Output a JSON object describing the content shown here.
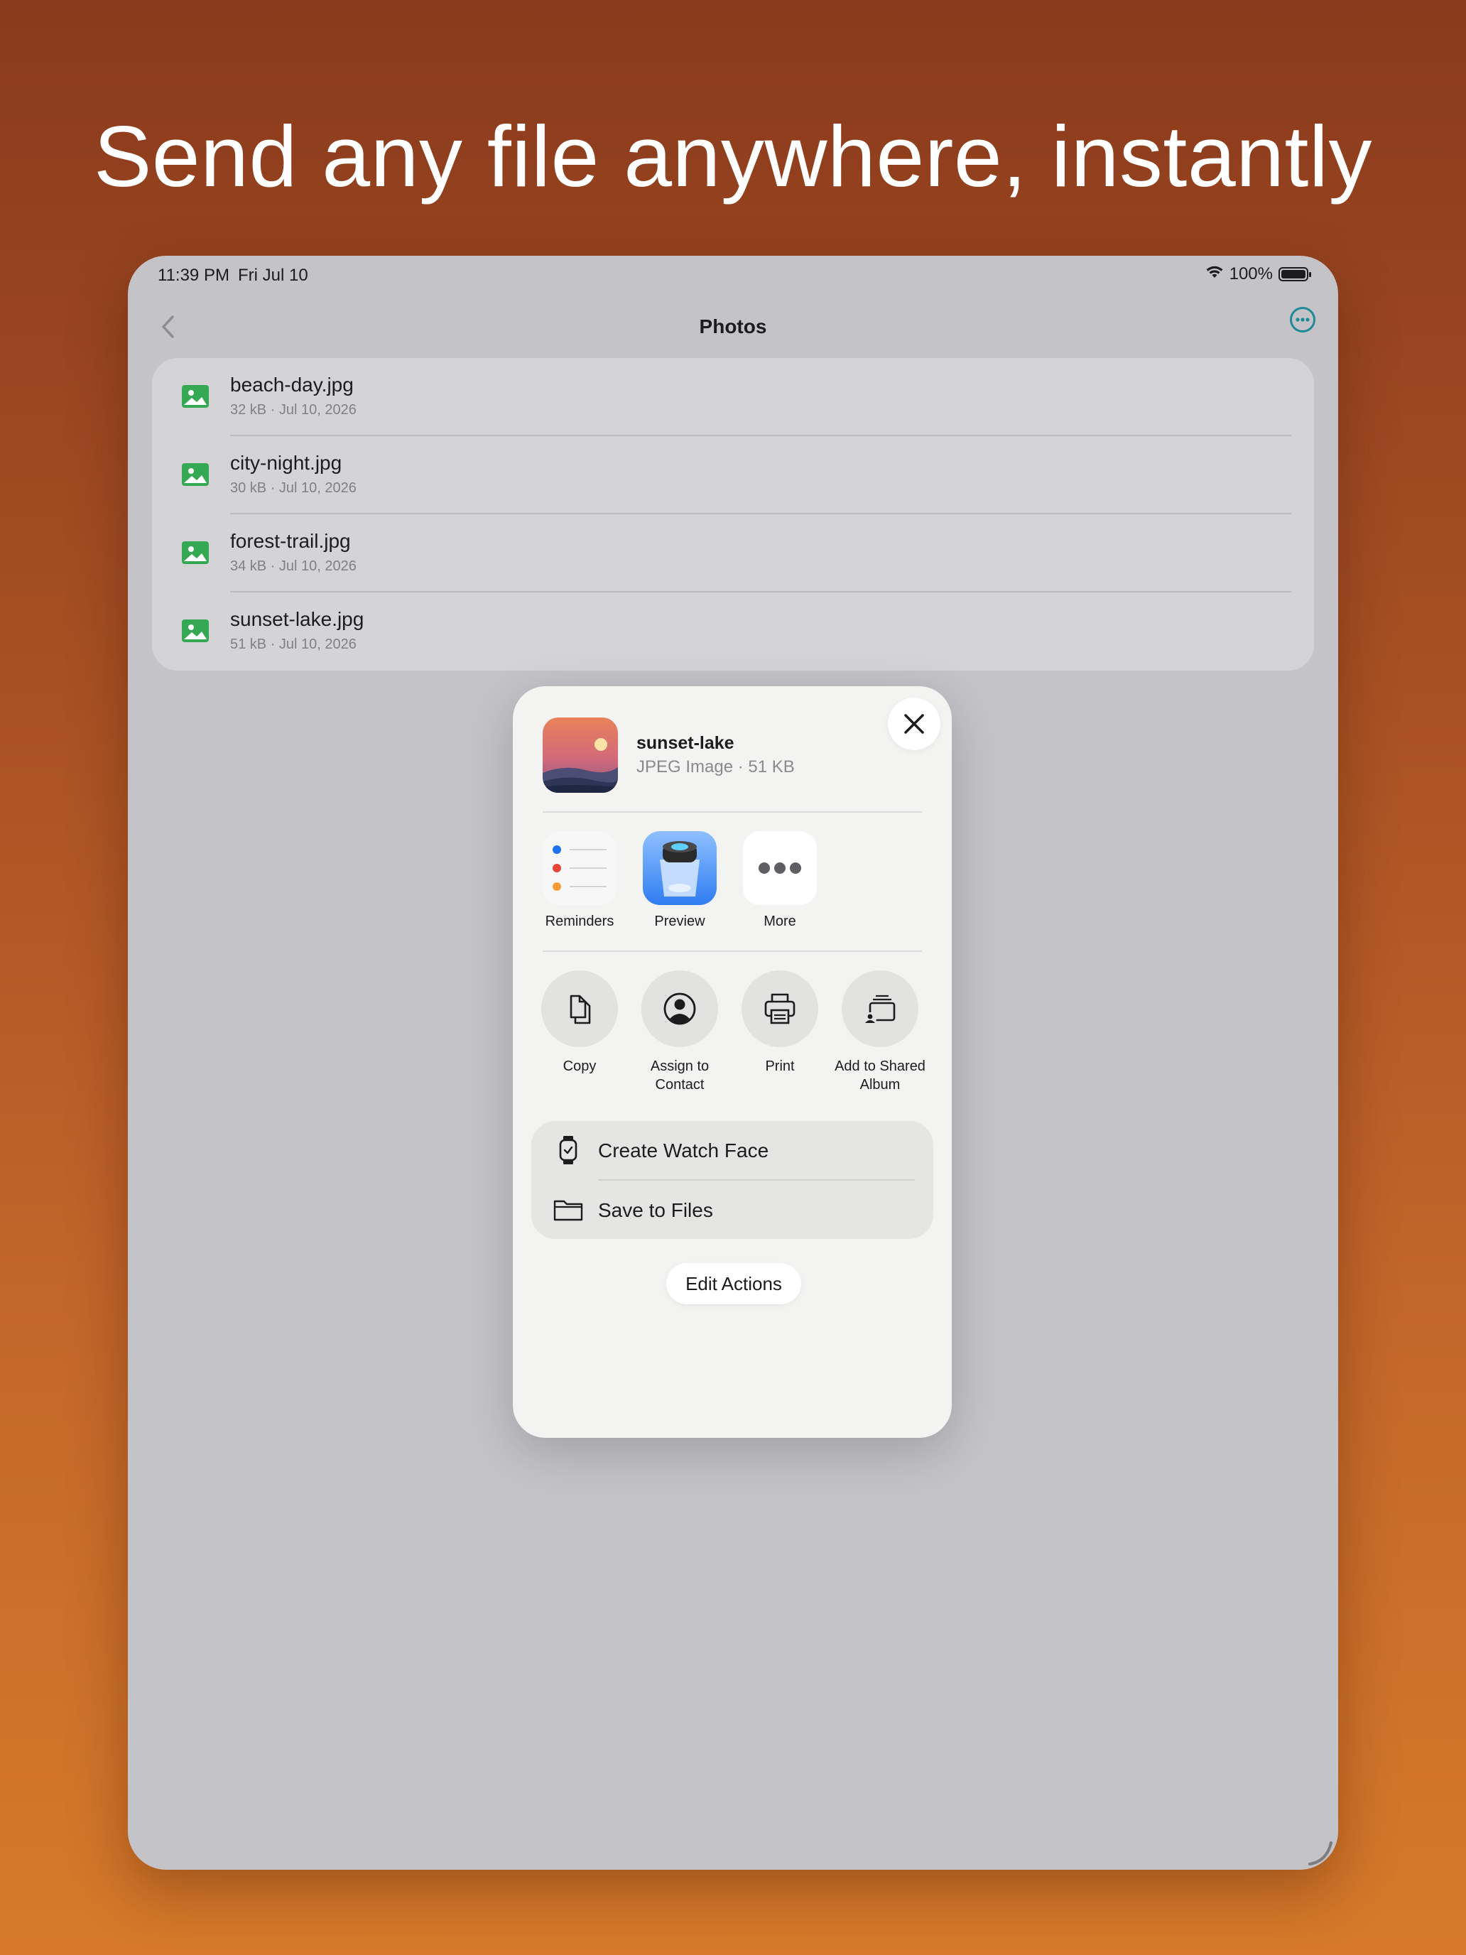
{
  "headline": "Send any file anywhere, instantly",
  "status_bar": {
    "time": "11:39 PM",
    "date": "Fri Jul 10",
    "battery": "100%"
  },
  "nav": {
    "title": "Photos"
  },
  "files": [
    {
      "name": "beach-day.jpg",
      "meta": "32 kB · Jul 10, 2026"
    },
    {
      "name": "city-night.jpg",
      "meta": "30 kB · Jul 10, 2026"
    },
    {
      "name": "forest-trail.jpg",
      "meta": "34 kB · Jul 10, 2026"
    },
    {
      "name": "sunset-lake.jpg",
      "meta": "51 kB · Jul 10, 2026"
    }
  ],
  "share_sheet": {
    "file_title": "sunset-lake",
    "file_subtitle": "JPEG Image · 51 KB",
    "apps": [
      {
        "label": "Reminders",
        "icon": "reminders-icon"
      },
      {
        "label": "Preview",
        "icon": "preview-icon"
      },
      {
        "label": "More",
        "icon": "more-icon"
      }
    ],
    "actions": [
      {
        "label": "Copy",
        "icon": "copy-icon"
      },
      {
        "label": "Assign to Contact",
        "icon": "contact-icon"
      },
      {
        "label": "Print",
        "icon": "print-icon"
      },
      {
        "label": "Add to Shared Album",
        "icon": "shared-album-icon"
      }
    ],
    "list_items": [
      {
        "label": "Create Watch Face",
        "icon": "watch-icon"
      },
      {
        "label": "Save to Files",
        "icon": "folder-icon"
      }
    ],
    "edit_actions": "Edit Actions"
  },
  "colors": {
    "background_top": "#8a3a1c",
    "background_bottom": "#d67a2a",
    "accent_teal": "#1f8a96",
    "file_icon_green": "#34a853"
  }
}
